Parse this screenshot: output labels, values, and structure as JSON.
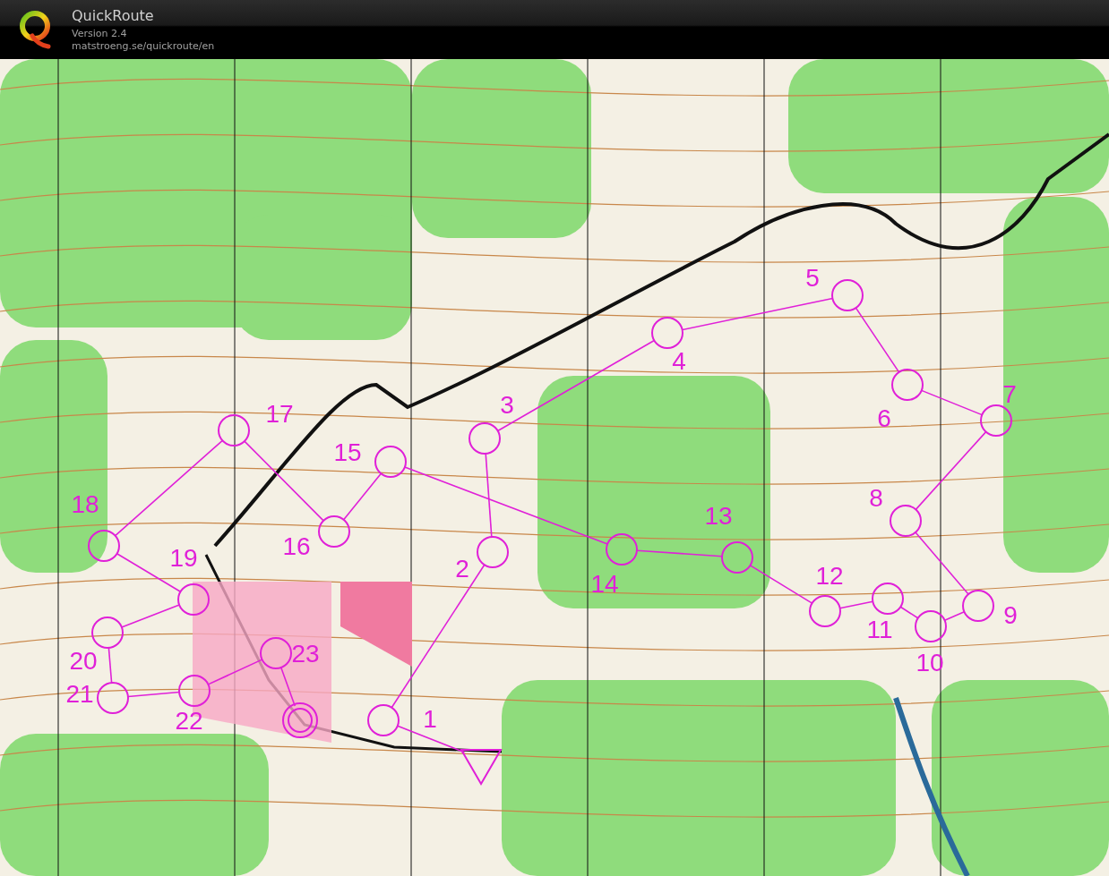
{
  "window": {
    "title": "QuickRoute",
    "version": "Version 2.4",
    "url": "matstroeng.se/quickroute/en"
  },
  "course": {
    "controls": [
      {
        "label": "1"
      },
      {
        "label": "2"
      },
      {
        "label": "3"
      },
      {
        "label": "4"
      },
      {
        "label": "5"
      },
      {
        "label": "6"
      },
      {
        "label": "7"
      },
      {
        "label": "8"
      },
      {
        "label": "9"
      },
      {
        "label": "10"
      },
      {
        "label": "11"
      },
      {
        "label": "12"
      },
      {
        "label": "13"
      },
      {
        "label": "14"
      },
      {
        "label": "15"
      },
      {
        "label": "16"
      },
      {
        "label": "17"
      },
      {
        "label": "18"
      },
      {
        "label": "19"
      },
      {
        "label": "20"
      },
      {
        "label": "21"
      },
      {
        "label": "22"
      },
      {
        "label": "23"
      }
    ]
  }
}
